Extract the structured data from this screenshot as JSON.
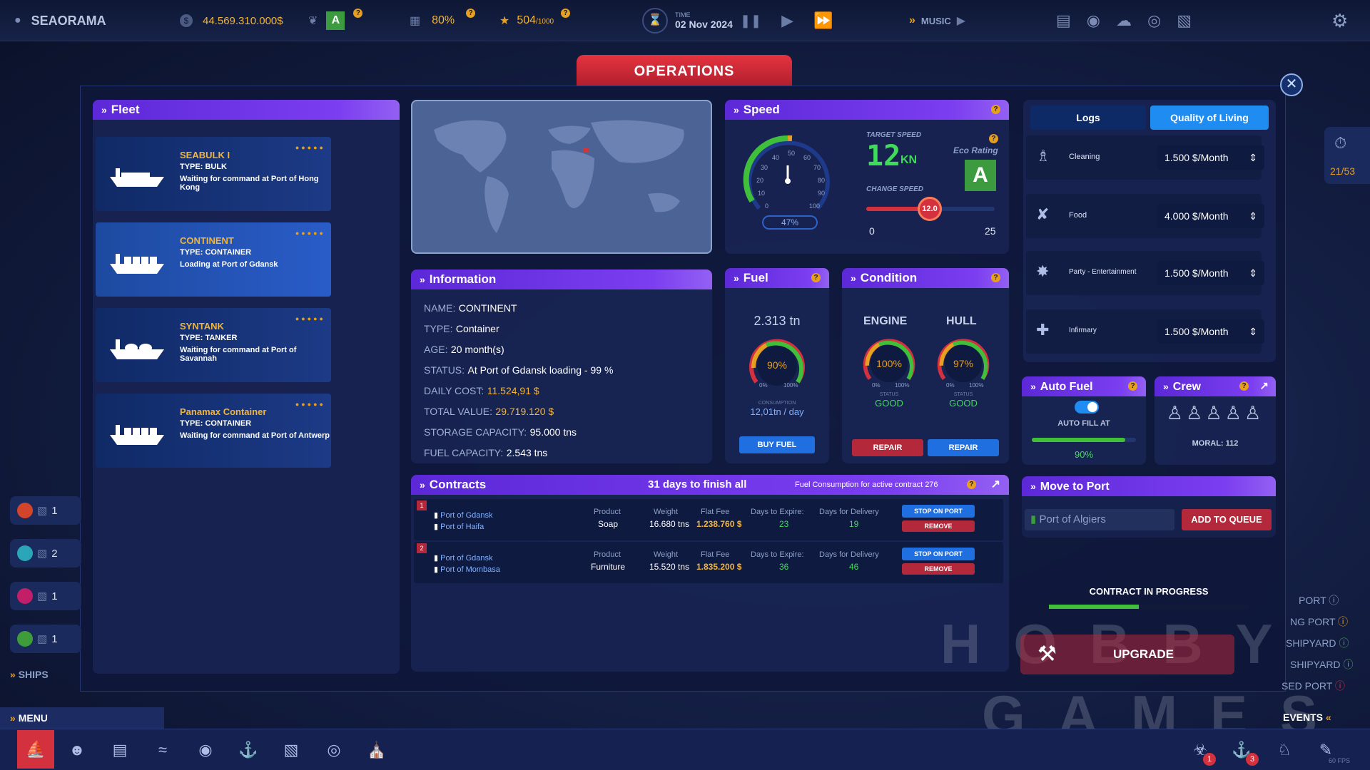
{
  "topbar": {
    "company": "SEAORAMA",
    "money": "44.569.310.000$",
    "eco_rating": "A",
    "percent": "80%",
    "stars_value": "504",
    "stars_max": "/1000",
    "time_label": "TIME",
    "date": "02 Nov 2024",
    "music_label": "MUSIC"
  },
  "window_title": "OPERATIONS",
  "fleet": {
    "title": "Fleet",
    "ships": [
      {
        "name": "SEABULK I",
        "type": "TYPE: BULK",
        "status": "Waiting for command at Port of Hong Kong",
        "icon": "bulk-ship-icon"
      },
      {
        "name": "CONTINENT",
        "type": "TYPE: CONTAINER",
        "status": "Loading at Port of Gdansk",
        "icon": "container-ship-icon"
      },
      {
        "name": "SYNTANK",
        "type": "TYPE: TANKER",
        "status": "Waiting for command at Port of Savannah",
        "icon": "tanker-ship-icon"
      },
      {
        "name": "Panamax Container",
        "type": "TYPE: CONTAINER",
        "status": "Waiting for command at Port of Antwerp",
        "icon": "container-ship-icon"
      }
    ]
  },
  "speed": {
    "title": "Speed",
    "gauge_ticks": [
      "0",
      "10",
      "20",
      "30",
      "40",
      "50",
      "60",
      "70",
      "80",
      "90",
      "100"
    ],
    "gauge_pct": "47%",
    "target_label": "TARGET SPEED",
    "target_value": "12",
    "target_unit": "KN",
    "eco_label": "Eco Rating",
    "eco_value": "A",
    "change_label": "CHANGE SPEED",
    "slider_value": "12.0",
    "slider_min": "0",
    "slider_max": "25"
  },
  "information": {
    "title": "Information",
    "rows": [
      {
        "label": "NAME:",
        "value": "CONTINENT"
      },
      {
        "label": "TYPE:",
        "value": "Container"
      },
      {
        "label": "AGE:",
        "value": "20 month(s)"
      },
      {
        "label": "STATUS:",
        "value": "At Port of Gdansk loading - 99 %"
      },
      {
        "label": "DAILY COST:",
        "value": "11.524,91 $"
      },
      {
        "label": "TOTAL VALUE:",
        "value": "29.719.120 $"
      },
      {
        "label": "STORAGE CAPACITY:",
        "value": "95.000 tns"
      },
      {
        "label": "FUEL CAPACITY:",
        "value": "2.543 tns"
      }
    ]
  },
  "fuel": {
    "title": "Fuel",
    "amount": "2.313 tn",
    "pct": "90%",
    "pct_min": "0%",
    "pct_max": "100%",
    "consumption_label": "CONSUMPTION",
    "consumption": "12,01tn / day",
    "buy_label": "BUY FUEL"
  },
  "condition": {
    "title": "Condition",
    "engine_label": "ENGINE",
    "hull_label": "HULL",
    "engine_pct": "100%",
    "hull_pct": "97%",
    "min": "0%",
    "max": "100%",
    "status_label": "STATUS",
    "engine_status": "GOOD",
    "hull_status": "GOOD",
    "repair_label": "REPAIR"
  },
  "contracts": {
    "title": "Contracts",
    "days_all": "31 days to finish all",
    "fuel_info": "Fuel Consumption for active contract 276",
    "col_product": "Product",
    "col_weight": "Weight",
    "col_fee": "Flat Fee",
    "col_expire": "Days to Expire:",
    "col_delivery": "Days for Delivery",
    "stop_label": "STOP ON PORT",
    "remove_label": "REMOVE",
    "rows": [
      {
        "num": "1",
        "from": "Port of Gdansk",
        "to": "Port of Haifa",
        "product": "Soap",
        "weight": "16.680 tns",
        "fee": "1.238.760 $",
        "expire": "23",
        "delivery": "19"
      },
      {
        "num": "2",
        "from": "Port of Gdansk",
        "to": "Port of Mombasa",
        "product": "Furniture",
        "weight": "15.520 tns",
        "fee": "1.835.200 $",
        "expire": "36",
        "delivery": "46"
      }
    ]
  },
  "tabs": {
    "logs": "Logs",
    "quality": "Quality of Living"
  },
  "quality": [
    {
      "label": "Cleaning",
      "value": "1.500 $/Month",
      "icon": "cleaning-icon"
    },
    {
      "label": "Food",
      "value": "4.000 $/Month",
      "icon": "food-icon"
    },
    {
      "label": "Party - Entertainment",
      "value": "1.500 $/Month",
      "icon": "party-icon"
    },
    {
      "label": "Infirmary",
      "value": "1.500 $/Month",
      "icon": "infirmary-icon"
    }
  ],
  "autofuel": {
    "title": "Auto Fuel",
    "label": "AUTO FILL AT",
    "value": "90%",
    "fill": 0.9
  },
  "crew": {
    "title": "Crew",
    "moral": "MORAL: 112"
  },
  "move": {
    "title": "Move to Port",
    "port": "Port of Algiers",
    "queue_label": "ADD TO QUEUE"
  },
  "contract_progress": {
    "label": "CONTRACT IN PROGRESS",
    "upgrade": "UPGRADE",
    "progress": 0.45
  },
  "side_right": {
    "counter": "21/53",
    "items": [
      "PORT",
      "NG PORT",
      "SHIPYARD",
      "SHIPYARD",
      "SED PORT"
    ],
    "events": "EVENTS"
  },
  "side_left": {
    "groups": [
      {
        "color": "#d2452b",
        "count": "1"
      },
      {
        "color": "#2aa6b8",
        "count": "2"
      },
      {
        "color": "#c21f68",
        "count": "1"
      },
      {
        "color": "#3e9c3b",
        "count": "1"
      }
    ],
    "ships_label": "SHIPS"
  },
  "menu_label": "MENU",
  "watermark": {
    "line1": "HOBBY",
    "line2": "GAMES"
  },
  "badges": {
    "b1": "1",
    "b2": "3"
  },
  "fps": "60 FPS"
}
